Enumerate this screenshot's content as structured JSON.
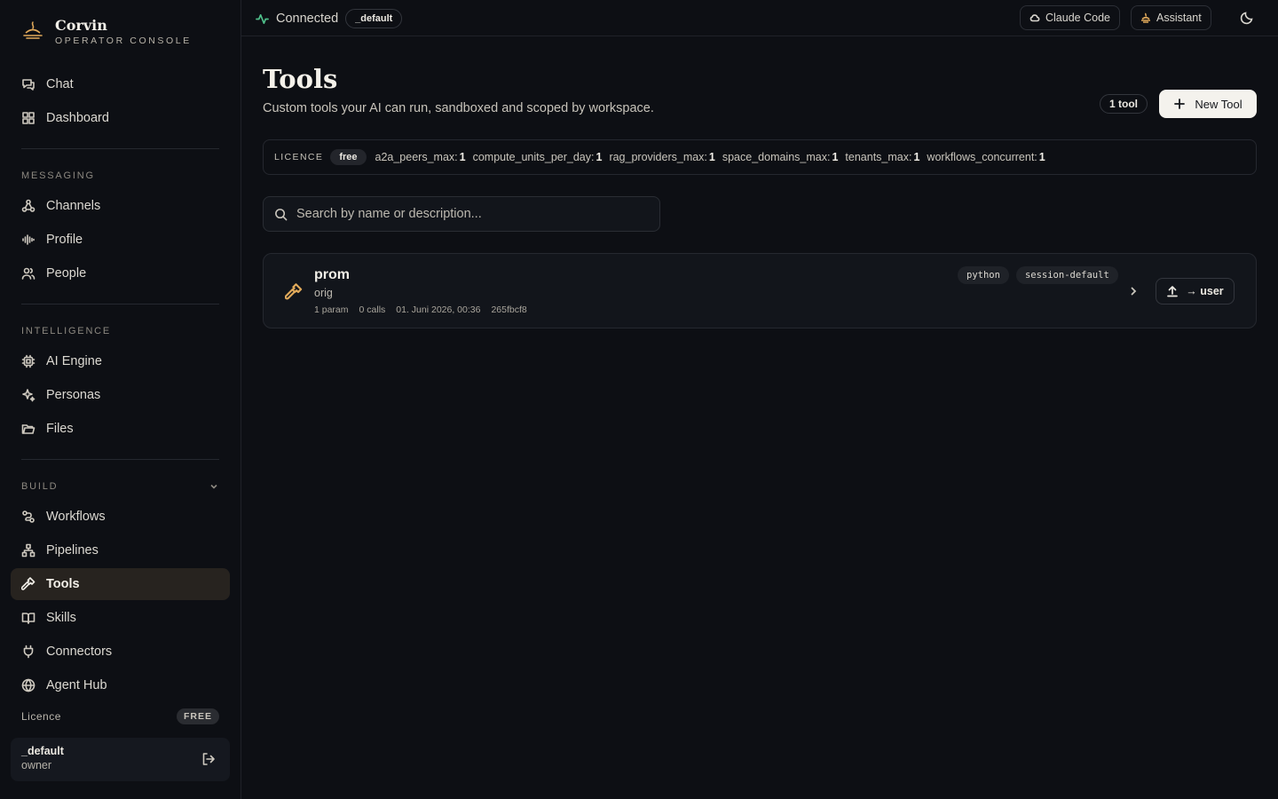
{
  "brand": {
    "name": "Corvin",
    "subtitle": "OPERATOR CONSOLE"
  },
  "sidebar": {
    "top": [
      {
        "label": "Chat",
        "icon": "chat-icon"
      },
      {
        "label": "Dashboard",
        "icon": "dashboard-icon"
      }
    ],
    "messaging": {
      "label": "MESSAGING",
      "items": [
        {
          "label": "Channels",
          "icon": "channels-icon"
        },
        {
          "label": "Profile",
          "icon": "audio-wave-icon"
        },
        {
          "label": "People",
          "icon": "people-icon"
        }
      ]
    },
    "intelligence": {
      "label": "INTELLIGENCE",
      "items": [
        {
          "label": "AI Engine",
          "icon": "chip-icon"
        },
        {
          "label": "Personas",
          "icon": "sparkles-icon"
        },
        {
          "label": "Files",
          "icon": "folder-icon"
        }
      ]
    },
    "build": {
      "label": "BUILD",
      "items": [
        {
          "label": "Workflows",
          "icon": "workflow-icon"
        },
        {
          "label": "Pipelines",
          "icon": "pipeline-icon"
        },
        {
          "label": "Tools",
          "icon": "hammer-icon",
          "active": true
        },
        {
          "label": "Skills",
          "icon": "book-icon"
        },
        {
          "label": "Connectors",
          "icon": "plug-icon"
        },
        {
          "label": "Agent Hub",
          "icon": "globe-icon"
        }
      ]
    },
    "licence": {
      "label": "Licence",
      "badge": "FREE"
    },
    "user": {
      "name": "_default",
      "role": "owner"
    }
  },
  "topbar": {
    "status": "Connected",
    "workspace": "_default",
    "claude_code": "Claude Code",
    "assistant": "Assistant"
  },
  "main": {
    "title": "Tools",
    "subtitle": "Custom tools your AI can run, sandboxed and scoped by workspace.",
    "count": "1 tool",
    "new_button": "New Tool",
    "licence": {
      "label": "LICENCE",
      "plan": "free",
      "limits": [
        {
          "key": "a2a_peers_max:",
          "value": "1"
        },
        {
          "key": "compute_units_per_day:",
          "value": "1"
        },
        {
          "key": "rag_providers_max:",
          "value": "1"
        },
        {
          "key": "space_domains_max:",
          "value": "1"
        },
        {
          "key": "tenants_max:",
          "value": "1"
        },
        {
          "key": "workflows_concurrent:",
          "value": "1"
        }
      ]
    },
    "search": {
      "placeholder": "Search by name or description..."
    },
    "tools": [
      {
        "name": "prom",
        "description": "orig",
        "params": "1 param",
        "calls": "0 calls",
        "date": "01. Juni 2026, 00:36",
        "hash": "265fbcf8",
        "tags": [
          "python",
          "session-default"
        ],
        "promote": "→ user"
      }
    ]
  },
  "colors": {
    "accent": "#e0a95a",
    "connected": "#4fbf8a",
    "background": "#0d0f14"
  }
}
